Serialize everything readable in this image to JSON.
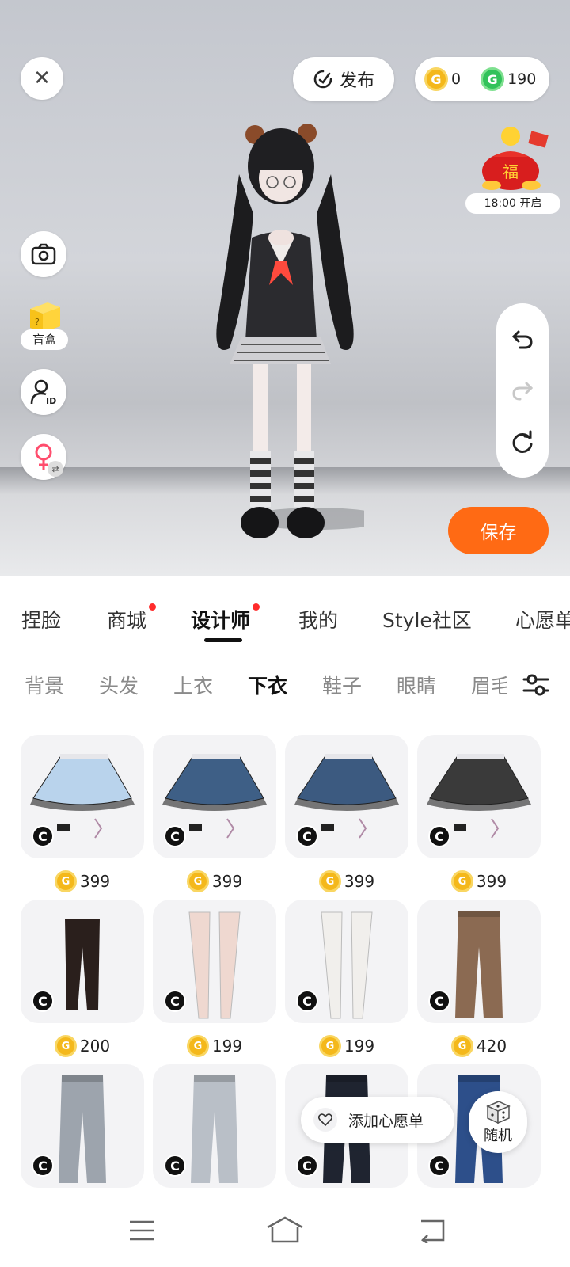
{
  "top_bar": {
    "publish_label": "发布",
    "gold_coin_count": "0",
    "green_coin_count": "190"
  },
  "event": {
    "time_label": "18:00 开启"
  },
  "side_tools": {
    "blind_box_label": "盲盒"
  },
  "save_label": "保存",
  "tabs": [
    {
      "label": "捏脸"
    },
    {
      "label": "商城"
    },
    {
      "label": "设计师"
    },
    {
      "label": "我的"
    },
    {
      "label": "Style社区"
    },
    {
      "label": "心愿单"
    }
  ],
  "subtabs": [
    {
      "label": "背景"
    },
    {
      "label": "头发"
    },
    {
      "label": "上衣"
    },
    {
      "label": "下衣"
    },
    {
      "label": "鞋子"
    },
    {
      "label": "眼睛"
    },
    {
      "label": "眉毛"
    }
  ],
  "items": [
    {
      "price": "399",
      "kind": "skirt",
      "color": "#b9d3ec"
    },
    {
      "price": "399",
      "kind": "skirt",
      "color": "#3e5f86"
    },
    {
      "price": "399",
      "kind": "skirt",
      "color": "#3c5a80"
    },
    {
      "price": "399",
      "kind": "skirt",
      "color": "#3a3a3a"
    },
    {
      "price": "200",
      "kind": "tights",
      "color": "#2a1f1c"
    },
    {
      "price": "199",
      "kind": "stockings",
      "color": "#efd8d0"
    },
    {
      "price": "199",
      "kind": "stockings",
      "color": "#f1efec"
    },
    {
      "price": "420",
      "kind": "pants",
      "color": "#8b6a52"
    },
    {
      "price": "",
      "kind": "pants",
      "color": "#9da4ad"
    },
    {
      "price": "",
      "kind": "pants",
      "color": "#b9bfc7"
    },
    {
      "price": "",
      "kind": "pants",
      "color": "#1f2430"
    },
    {
      "price": "",
      "kind": "pants",
      "color": "#2d4f8a"
    }
  ],
  "wishlist_label": "添加心愿单",
  "random_label": "随机",
  "colors": {
    "accent": "#ff6a14",
    "badge_red": "#ff2b2b",
    "gold": "#f4b81b",
    "green": "#32c25a"
  }
}
